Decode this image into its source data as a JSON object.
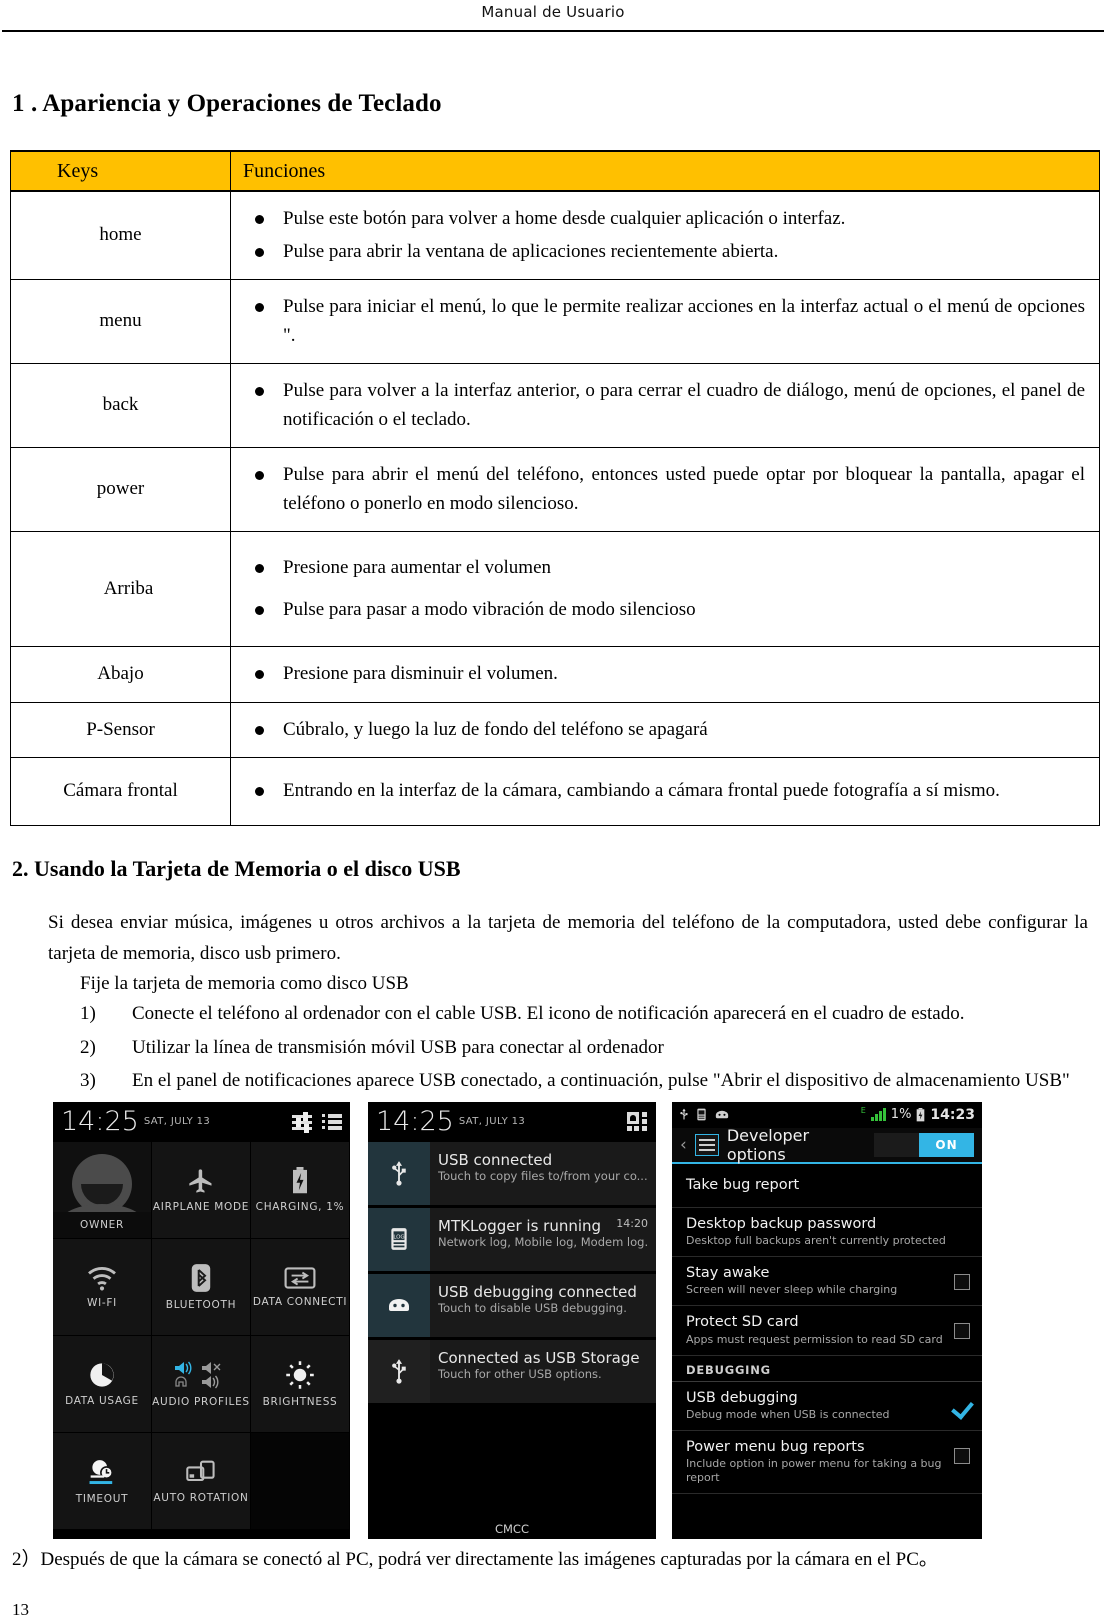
{
  "header": {
    "title": "Manual de Usuario"
  },
  "section1": {
    "heading": "1 . Apariencia y Operaciones de Teclado",
    "table": {
      "columns": [
        "Keys",
        "Funciones"
      ],
      "rows": [
        {
          "key": "home",
          "items": [
            "Pulse este botón para volver a home desde cualquier aplicación o interfaz.",
            "Pulse para abrir la ventana de aplicaciones recientemente abierta."
          ]
        },
        {
          "key": "menu",
          "items": [
            "Pulse para iniciar el menú, lo que le permite realizar acciones en la interfaz actual o el menú de opciones \"."
          ]
        },
        {
          "key": "back",
          "items": [
            "Pulse para volver a la interfaz anterior, o para cerrar el cuadro de diálogo, menú de opciones, el panel de notificación o el teclado."
          ]
        },
        {
          "key": "power",
          "items": [
            "Pulse para abrir el menú del teléfono, entonces usted puede optar por bloquear la pantalla, apagar el teléfono o ponerlo en modo silencioso."
          ]
        },
        {
          "key": "Arriba",
          "items": [
            "Presione para aumentar el volumen",
            "Pulse para pasar a modo vibración de modo silencioso"
          ]
        },
        {
          "key": "Abajo",
          "items": [
            "Presione para disminuir el volumen."
          ]
        },
        {
          "key": "P-Sensor",
          "items": [
            "Cúbralo, y luego la luz de fondo del teléfono se apagará"
          ]
        },
        {
          "key": "Cámara frontal",
          "items": [
            "Entrando en la interfaz de la cámara, cambiando a cámara frontal puede fotografía a sí mismo."
          ]
        }
      ]
    }
  },
  "section2": {
    "heading": "2. Usando la Tarjeta de Memoria o el disco USB",
    "paragraph": "Si desea enviar música, imágenes u otros archivos a la tarjeta de memoria del teléfono de la computadora, usted debe configurar la tarjeta de memoria, disco usb primero.",
    "subline": "Fije la tarjeta de memoria como disco USB",
    "steps": [
      {
        "num": "1)",
        "text": "Conecte el teléfono al ordenador con el cable USB. El icono de notificación aparecerá en el cuadro de estado."
      },
      {
        "num": "2)",
        "text": "Utilizar la línea de transmisión móvil USB para conectar al ordenador"
      },
      {
        "num": "3)",
        "text": "En el panel de notificaciones aparece USB conectado, a continuación, pulse \"Abrir el dispositivo de almacenamiento USB\""
      }
    ]
  },
  "screenshot_quick_settings": {
    "status": {
      "time": "14:25",
      "date": "SAT, JULY 13"
    },
    "tiles": [
      {
        "label": "OWNER",
        "type": "avatar"
      },
      {
        "label": "AIRPLANE MODE",
        "icon": "airplane-icon"
      },
      {
        "label": "CHARGING, 1%",
        "icon": "battery-charging-icon"
      },
      {
        "label": "WI-FI",
        "icon": "wifi-icon"
      },
      {
        "label": "BLUETOOTH",
        "icon": "bluetooth-icon"
      },
      {
        "label": "DATA CONNECTI",
        "icon": "data-connection-icon"
      },
      {
        "label": "DATA USAGE",
        "icon": "data-usage-icon"
      },
      {
        "label": "AUDIO PROFILES",
        "icon": "audio-profiles-icon"
      },
      {
        "label": "BRIGHTNESS",
        "icon": "brightness-icon"
      },
      {
        "label": "TIMEOUT",
        "icon": "timeout-icon"
      },
      {
        "label": "AUTO ROTATION",
        "icon": "auto-rotation-icon"
      },
      {
        "label": "",
        "icon": ""
      }
    ]
  },
  "screenshot_notifications": {
    "status": {
      "time": "14:25",
      "date": "SAT, JULY 13"
    },
    "items": [
      {
        "title": "USB connected",
        "subtitle": "Touch to copy files to/from your co...",
        "time": "",
        "icon": "usb-icon"
      },
      {
        "title": "MTKLogger is running",
        "subtitle": "Network log, Mobile log, Modem log...",
        "time": "14:20",
        "icon": "logger-icon"
      },
      {
        "title": "USB debugging connected",
        "subtitle": "Touch to disable USB debugging.",
        "time": "",
        "icon": "android-icon"
      },
      {
        "title": "Connected as USB Storage",
        "subtitle": "Touch for other USB options.",
        "time": "",
        "icon": "usb-icon"
      }
    ],
    "carrier": "CMCC"
  },
  "screenshot_developer": {
    "status": {
      "battery": "1%",
      "time": "14:23",
      "network": "E"
    },
    "title": "Developer options",
    "toggle": "ON",
    "items": [
      {
        "title": "Take bug report",
        "subtitle": "",
        "checkbox": "none"
      },
      {
        "title": "Desktop backup password",
        "subtitle": "Desktop full backups aren't currently protected",
        "checkbox": "none"
      },
      {
        "title": "Stay awake",
        "subtitle": "Screen will never sleep while charging",
        "checkbox": "unchecked"
      },
      {
        "title": "Protect SD card",
        "subtitle": "Apps must request permission to read SD card",
        "checkbox": "unchecked"
      }
    ],
    "section_label": "DEBUGGING",
    "debug_items": [
      {
        "title": "USB debugging",
        "subtitle": "Debug mode when USB is connected",
        "checkbox": "checked"
      },
      {
        "title": "Power menu bug reports",
        "subtitle": "Include option in power menu for taking a bug report",
        "checkbox": "unchecked"
      }
    ]
  },
  "footer": {
    "note": "2）Después de que la cámara se conectó al PC, podrá ver directamente las imágenes capturadas por la cámara en el PC。",
    "page_number": "13"
  },
  "colors": {
    "table_header": "#ffc000",
    "accent_blue": "#33b5e5",
    "signal_green": "#35c13a"
  }
}
